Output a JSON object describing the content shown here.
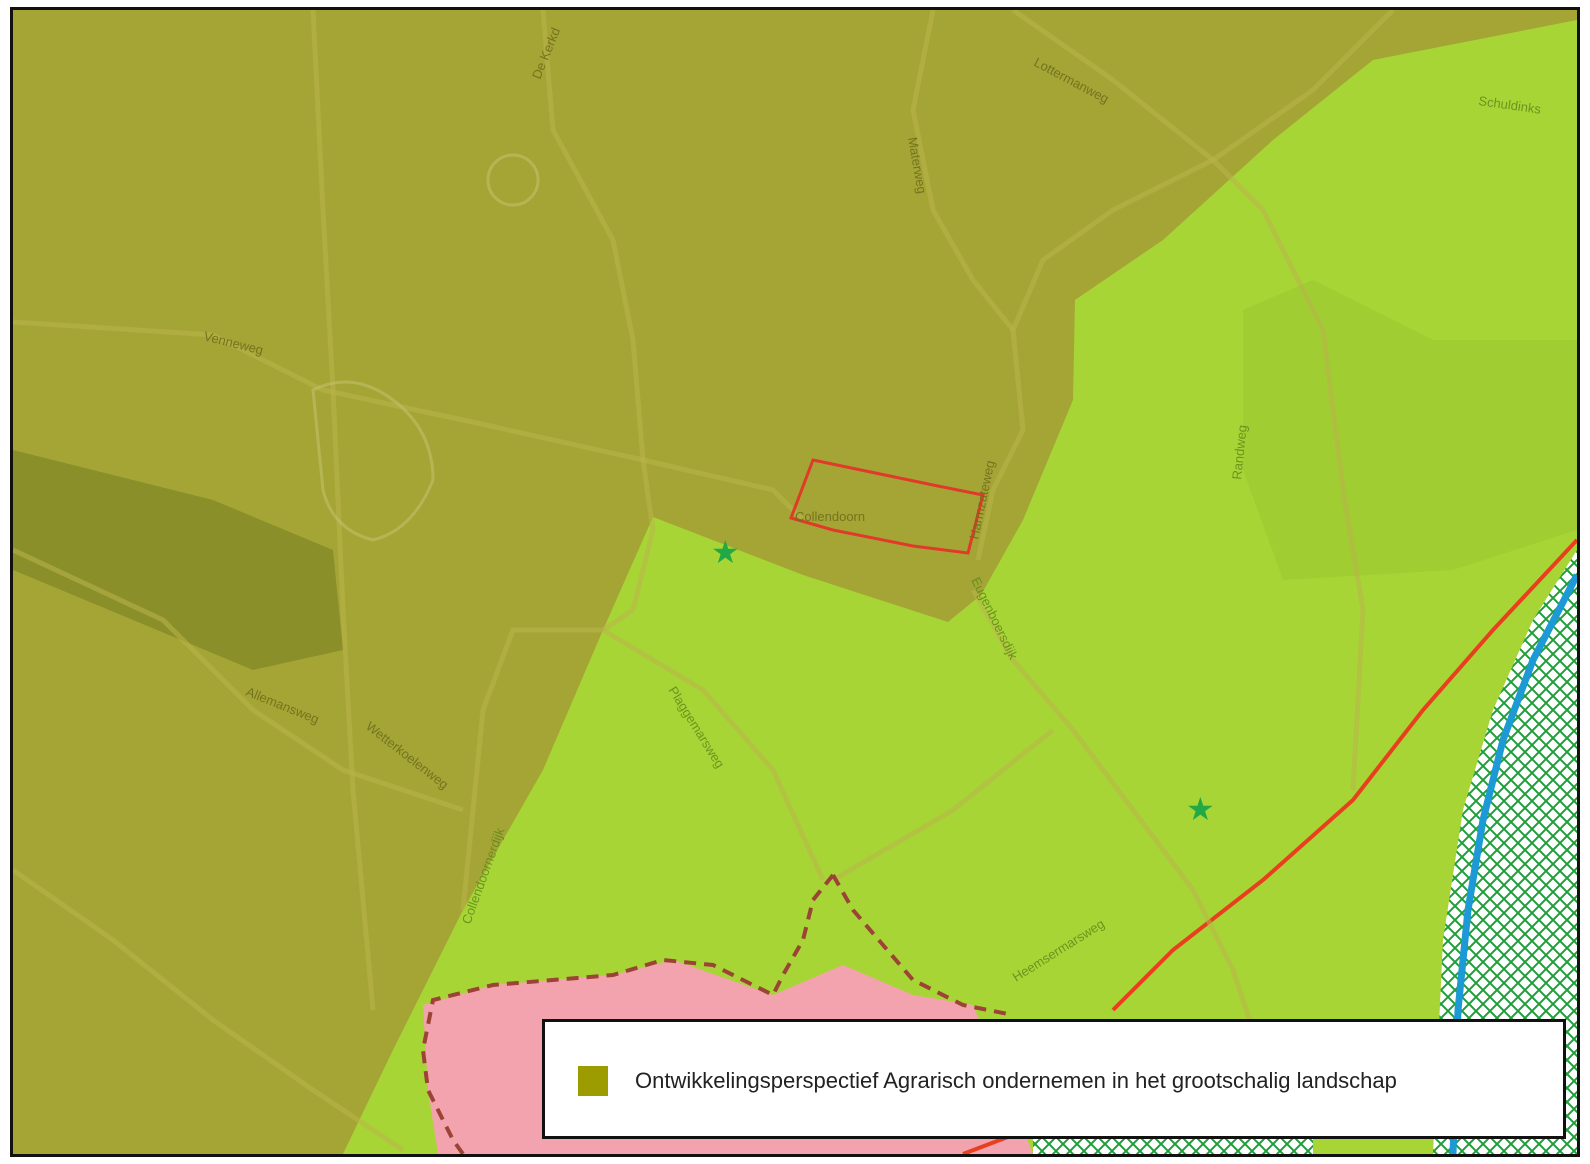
{
  "map": {
    "colors": {
      "olive_zone": "#a5a535",
      "green_zone": "#a8d536",
      "built_area": "#f3a3ad",
      "red_outline": "#e03a2a",
      "boundary_dashed": "#9b4436",
      "water_channel": "#1d9ad6",
      "nature_hatch": "#1f9e3a",
      "star": "#22a844"
    },
    "road_labels": {
      "de_kerkdijk": "De Kerkd",
      "lottermanweg": "Lottermanweg",
      "schuldinks": "Schuldinks",
      "materweg": "Materweg",
      "venneweg": "Venneweg",
      "collendoorn": "Collendoorn",
      "harmzateweg": "Harmzateweg",
      "randweg": "Randweg",
      "eugenboersdijk": "Eugenboersdijk",
      "allemansweg": "Allemansweg",
      "wetterkoelenweg": "Wetterkoelenweg",
      "plaggemarsweg": "Plaggemarsweg",
      "collendoornerdijk": "Collendoornerdijk",
      "heemsermarsweg": "Heemsermarsweg"
    }
  },
  "legend": {
    "swatch_color": "#9c9c00",
    "label": "Ontwikkelingsperspectief Agrarisch ondernemen in het grootschalig landschap"
  }
}
